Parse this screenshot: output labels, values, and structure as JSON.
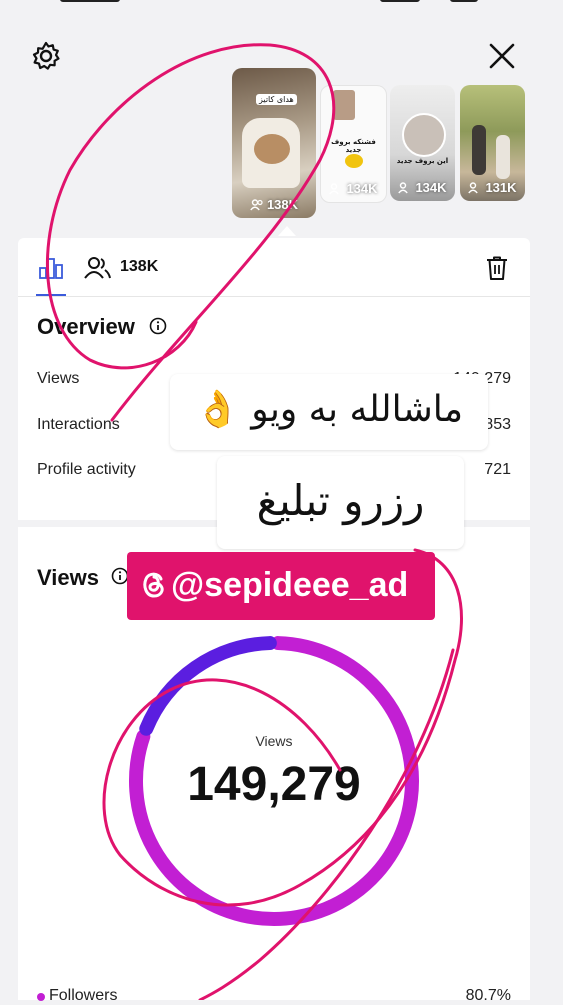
{
  "header": {
    "settings_icon": "gear-icon",
    "close_icon": "close-icon"
  },
  "thumbnails": [
    {
      "caption": "هدای کاتیز",
      "count": "138K",
      "selected": true
    },
    {
      "caption": "فشنکه بروف جدید",
      "count": "134K"
    },
    {
      "caption": "این بروف جدید",
      "count": "134K"
    },
    {
      "caption": "",
      "count": "131K"
    }
  ],
  "tabs": {
    "insights_icon": "bar-chart-icon",
    "audience_icon": "people-icon",
    "audience_count": "138K",
    "delete_icon": "trash-icon"
  },
  "overview": {
    "title": "Overview",
    "rows": [
      {
        "label": "Views",
        "value": "149,279"
      },
      {
        "label": "Interactions",
        "value": "853"
      },
      {
        "label": "Profile activity",
        "value": "721"
      }
    ]
  },
  "views_section": {
    "title": "Views",
    "donut_label": "Views",
    "donut_value": "149,279",
    "followers_share": 0.193,
    "legend": [
      {
        "label": "Followers",
        "value": "80.7%"
      }
    ],
    "colors": {
      "followers": "#c21fd3",
      "non_followers": "#5b1ee0"
    }
  },
  "stickers": {
    "text1": "ماشالله به ویو 👌",
    "text2": "رزرو تبلیغ",
    "handle": "@sepideee_ad"
  },
  "annotation_color": "#e0136c"
}
